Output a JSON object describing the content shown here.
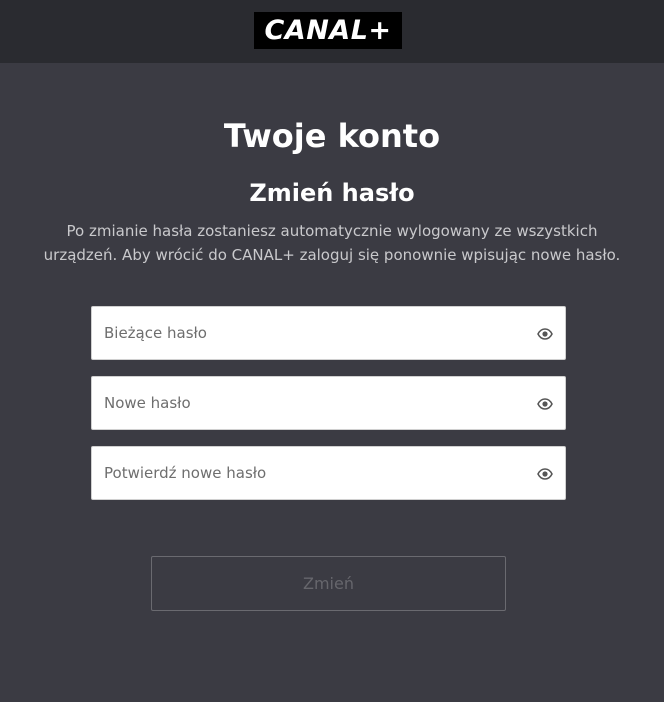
{
  "header": {
    "logo_text": "CANAL+"
  },
  "page": {
    "title": "Twoje konto",
    "subtitle": "Zmień hasło",
    "description_line1": "Po zmianie hasła zostaniesz automatycznie wylogowany ze wszystkich",
    "description_line2": "urządzeń. Aby wrócić do CANAL+ zaloguj się ponownie wpisując nowe hasło."
  },
  "form": {
    "current_password": {
      "placeholder": "Bieżące hasło",
      "value": ""
    },
    "new_password": {
      "placeholder": "Nowe hasło",
      "value": ""
    },
    "confirm_password": {
      "placeholder": "Potwierdź nowe hasło",
      "value": ""
    },
    "submit_label": "Zmień",
    "icons": {
      "toggle_visibility": "eye-icon"
    }
  },
  "colors": {
    "background": "#3b3b43",
    "topbar": "#2a2b30",
    "logo_bg": "#000000",
    "input_bg": "#ffffff",
    "button_border": "#6a6a70",
    "button_text_disabled": "#66666c"
  }
}
